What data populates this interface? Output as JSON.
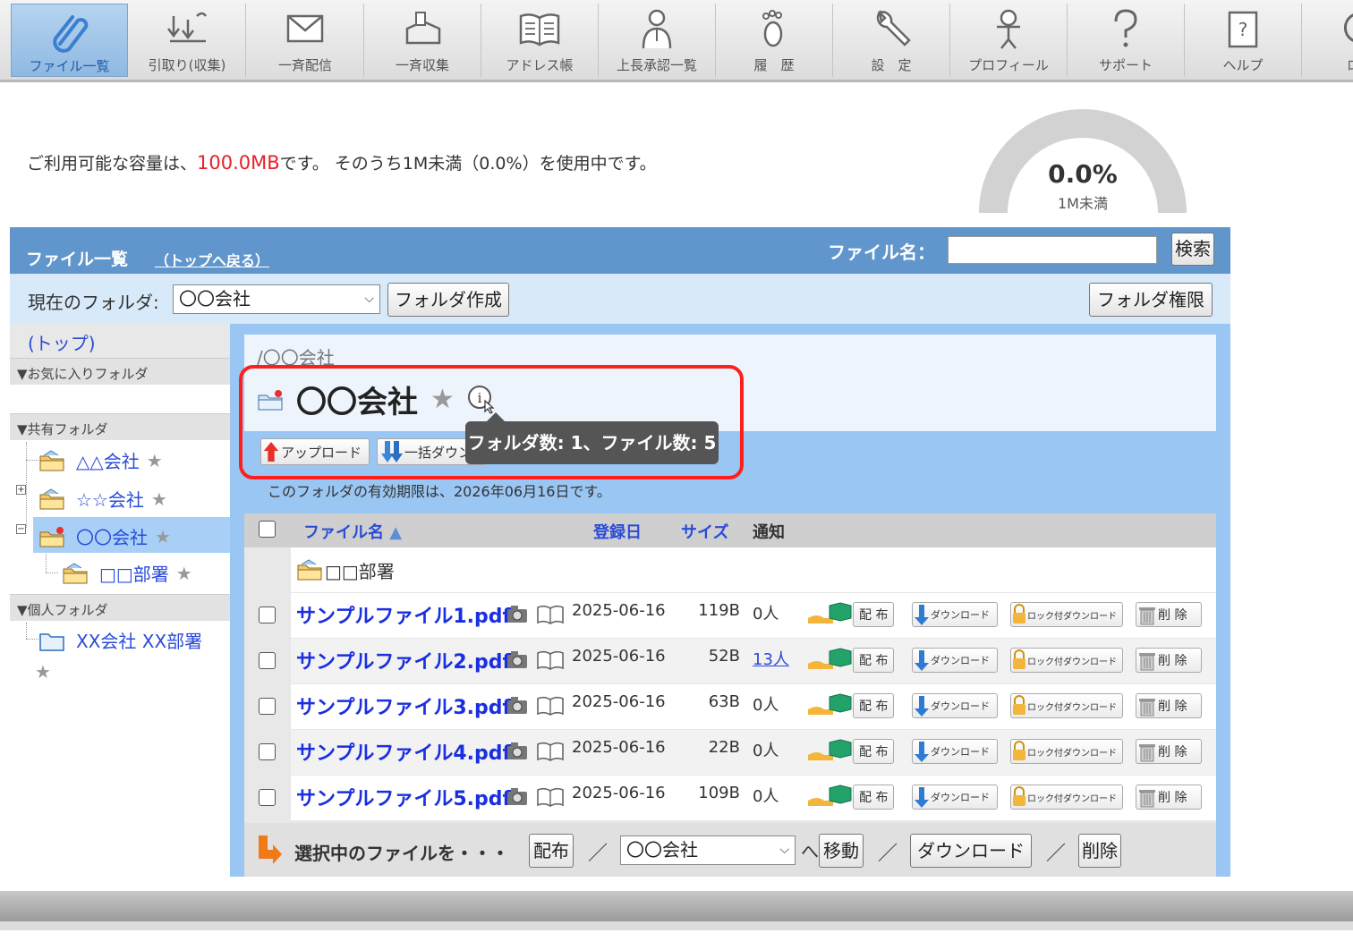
{
  "toolbar": {
    "items": [
      {
        "label": "ファイル一覧",
        "icon": "paperclip-icon"
      },
      {
        "label": "引取り(収集)",
        "icon": "collect-icon"
      },
      {
        "label": "一斉配信",
        "icon": "envelope-icon"
      },
      {
        "label": "一斉収集",
        "icon": "box-icon"
      },
      {
        "label": "アドレス帳",
        "icon": "address-book-icon"
      },
      {
        "label": "上長承認一覧",
        "icon": "manager-icon"
      },
      {
        "label": "履　歴",
        "icon": "footprint-icon"
      },
      {
        "label": "設　定",
        "icon": "wrench-icon"
      },
      {
        "label": "プロフィール",
        "icon": "profile-icon"
      },
      {
        "label": "サポート",
        "icon": "question-icon"
      },
      {
        "label": "ヘルプ",
        "icon": "help-book-icon"
      },
      {
        "label": "ログ",
        "icon": "logout-icon"
      }
    ]
  },
  "quota": {
    "prefix": "ご利用可能な容量は、",
    "amount": "100.0MB",
    "suffix": "です。 そのうち1M未満（0.0%）を使用中です。",
    "gauge_percent": "0.0%",
    "gauge_used": "1M未満",
    "gauge_fraction": 0.0
  },
  "header": {
    "title": "ファイル一覧",
    "back_link": "（トップへ戻る）",
    "search_label": "ファイル名：",
    "search_value": "",
    "search_button": "検索"
  },
  "folder_bar": {
    "label": "現在のフォルダ:",
    "current": "〇〇会社",
    "create_button": "フォルダ作成",
    "permission_button": "フォルダ権限"
  },
  "sidebar": {
    "top_link": "(トップ)",
    "favorites_heading": "▼お気に入りフォルダ",
    "shared_heading": "▼共有フォルダ",
    "shared_folders": [
      {
        "name": "△△会社"
      },
      {
        "name": "☆☆会社"
      },
      {
        "name": "〇〇会社"
      },
      {
        "name": "□□部署"
      }
    ],
    "personal_heading": "▼個人フォルダ",
    "personal_folder": "XX会社 XX部署"
  },
  "panel": {
    "breadcrumb": "/〇〇会社",
    "title": "〇〇会社",
    "upload_button": "アップロード",
    "bulk_download_button": "一括ダウン",
    "tooltip": "フォルダ数: 1、ファイル数: 5",
    "expiry_notice": "このフォルダの有効期限は、2026年06月16日です。"
  },
  "table": {
    "columns": {
      "name": "ファイル名",
      "date": "登録日",
      "size": "サイズ",
      "notify": "通知"
    },
    "subfolder": "□□部署",
    "rows": [
      {
        "name": "サンプルファイル1.pdf",
        "date": "2025-06-16",
        "size": "119B",
        "notify": "0人",
        "notify_link": false
      },
      {
        "name": "サンプルファイル2.pdf",
        "date": "2025-06-16",
        "size": "52B",
        "notify": "13人",
        "notify_link": true
      },
      {
        "name": "サンプルファイル3.pdf",
        "date": "2025-06-16",
        "size": "63B",
        "notify": "0人",
        "notify_link": false
      },
      {
        "name": "サンプルファイル4.pdf",
        "date": "2025-06-16",
        "size": "22B",
        "notify": "0人",
        "notify_link": false
      },
      {
        "name": "サンプルファイル5.pdf",
        "date": "2025-06-16",
        "size": "109B",
        "notify": "0人",
        "notify_link": false
      }
    ],
    "row_actions": {
      "distribute": "配 布",
      "download": "ダウンロード",
      "lock_download": "ロック付ダウンロード",
      "delete": "削 除"
    }
  },
  "footer": {
    "label": "選択中のファイルを・・・",
    "distribute_button": "配布",
    "separator": "／",
    "target_folder": "〇〇会社",
    "move_prefix": "へ",
    "move_button": "移動",
    "download_button": "ダウンロード",
    "delete_button": "削除"
  },
  "colors": {
    "header_blue": "#6096cc",
    "frame_blue": "#99c6f2",
    "link_blue": "#1a2fe0",
    "accent_red": "#e8202a",
    "highlight_red": "#ff1e1e"
  }
}
